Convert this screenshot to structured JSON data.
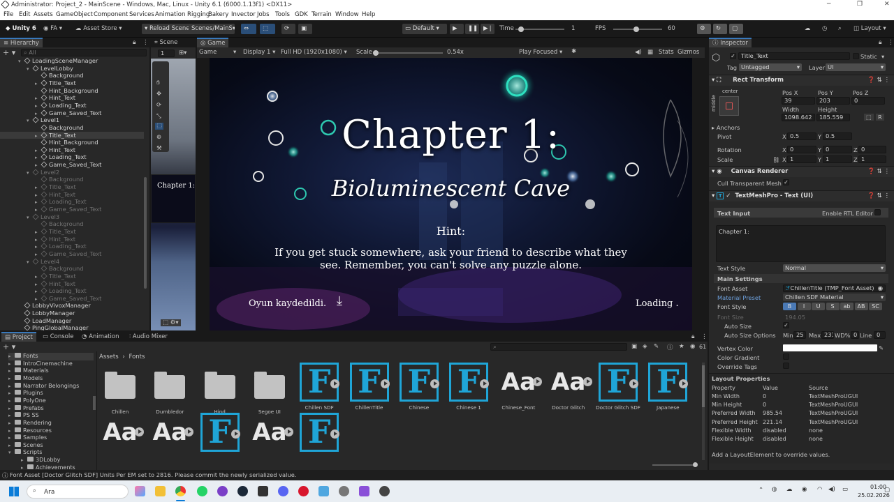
{
  "window": {
    "title": "Administrator: Project_2 - MainScene - Windows, Mac, Linux - Unity 6.1 (6000.1.13f1) <DX11>"
  },
  "menu": [
    "File",
    "Edit",
    "Assets",
    "GameObject",
    "Component",
    "Services",
    "Animation Rigging",
    "Bakery",
    "Invector",
    "Jobs",
    "Tools",
    "GDK",
    "Terrain",
    "Window",
    "Help"
  ],
  "toolbar": {
    "account": "Unity 6",
    "user": "FA",
    "asset_store": "Asset Store",
    "reload_scene": "Reload Scene",
    "scenes": "Scenes/MainS",
    "play_mode": "Default",
    "time_label": "Time",
    "time_value": "1",
    "fps_label": "FPS",
    "fps_value": "60",
    "layout": "Layout"
  },
  "hierarchy": {
    "tab": "Hierarchy",
    "search_placeholder": "All",
    "rows": [
      {
        "label": "LoadingSceneManager",
        "indent": 1,
        "arrow": "▾",
        "dim": false
      },
      {
        "label": "LevelLobby",
        "indent": 2,
        "arrow": "▾",
        "dim": false
      },
      {
        "label": "Background",
        "indent": 3,
        "arrow": "",
        "dim": false
      },
      {
        "label": "Title_Text",
        "indent": 3,
        "arrow": "▸",
        "dim": false
      },
      {
        "label": "Hint_Background",
        "indent": 3,
        "arrow": "",
        "dim": false
      },
      {
        "label": "Hint_Text",
        "indent": 3,
        "arrow": "▸",
        "dim": false
      },
      {
        "label": "Loading_Text",
        "indent": 3,
        "arrow": "▸",
        "dim": false
      },
      {
        "label": "Game_Saved_Text",
        "indent": 3,
        "arrow": "▸",
        "dim": false
      },
      {
        "label": "Level1",
        "indent": 2,
        "arrow": "▾",
        "dim": false
      },
      {
        "label": "Background",
        "indent": 3,
        "arrow": "",
        "dim": false
      },
      {
        "label": "Title_Text",
        "indent": 3,
        "arrow": "▸",
        "dim": false,
        "selected": true
      },
      {
        "label": "Hint_Background",
        "indent": 3,
        "arrow": "",
        "dim": false
      },
      {
        "label": "Hint_Text",
        "indent": 3,
        "arrow": "▸",
        "dim": false
      },
      {
        "label": "Loading_Text",
        "indent": 3,
        "arrow": "▸",
        "dim": false
      },
      {
        "label": "Game_Saved_Text",
        "indent": 3,
        "arrow": "▸",
        "dim": false
      },
      {
        "label": "Level2",
        "indent": 2,
        "arrow": "▾",
        "dim": true
      },
      {
        "label": "Background",
        "indent": 3,
        "arrow": "",
        "dim": true
      },
      {
        "label": "Title_Text",
        "indent": 3,
        "arrow": "▸",
        "dim": true
      },
      {
        "label": "Hint_Text",
        "indent": 3,
        "arrow": "▸",
        "dim": true
      },
      {
        "label": "Loading_Text",
        "indent": 3,
        "arrow": "▸",
        "dim": true
      },
      {
        "label": "Game_Saved_Text",
        "indent": 3,
        "arrow": "▸",
        "dim": true
      },
      {
        "label": "Level3",
        "indent": 2,
        "arrow": "▾",
        "dim": true
      },
      {
        "label": "Background",
        "indent": 3,
        "arrow": "",
        "dim": true
      },
      {
        "label": "Title_Text",
        "indent": 3,
        "arrow": "▸",
        "dim": true
      },
      {
        "label": "Hint_Text",
        "indent": 3,
        "arrow": "▸",
        "dim": true
      },
      {
        "label": "Loading_Text",
        "indent": 3,
        "arrow": "▸",
        "dim": true
      },
      {
        "label": "Game_Saved_Text",
        "indent": 3,
        "arrow": "▸",
        "dim": true
      },
      {
        "label": "Level4",
        "indent": 2,
        "arrow": "▾",
        "dim": true
      },
      {
        "label": "Background",
        "indent": 3,
        "arrow": "",
        "dim": true
      },
      {
        "label": "Title_Text",
        "indent": 3,
        "arrow": "▸",
        "dim": true
      },
      {
        "label": "Hint_Text",
        "indent": 3,
        "arrow": "▸",
        "dim": true
      },
      {
        "label": "Loading_Text",
        "indent": 3,
        "arrow": "▸",
        "dim": true
      },
      {
        "label": "Game_Saved_Text",
        "indent": 3,
        "arrow": "▸",
        "dim": true
      },
      {
        "label": "LobbyVivoxManager",
        "indent": 1,
        "arrow": "",
        "dim": false
      },
      {
        "label": "LobbyManager",
        "indent": 1,
        "arrow": "",
        "dim": false
      },
      {
        "label": "LoadManager",
        "indent": 1,
        "arrow": "",
        "dim": false
      },
      {
        "label": "PingGlobalManager",
        "indent": 1,
        "arrow": "",
        "dim": false
      }
    ]
  },
  "scene_tab": {
    "label": "Scene",
    "zoom": "1"
  },
  "game": {
    "tab": "Game",
    "mode": "Game",
    "display": "Display 1",
    "resolution": "Full HD (1920x1080)",
    "scale_label": "Scale",
    "scale_value": "0.54x",
    "play_focused": "Play Focused",
    "stats": "Stats",
    "gizmos": "Gizmos",
    "title": "Chapter 1:",
    "subtitle": "Bioluminescent Cave",
    "hint_title": "Hint:",
    "hint_line1": "If you get stuck somewhere, ask your friend to describe what they",
    "hint_line2": "see. Remember, you can't solve any puzzle alone.",
    "saved_text": "Oyun kaydedildi.",
    "loading_text": "Loading ."
  },
  "inspector": {
    "tab": "Inspector",
    "object_name": "Title_Text",
    "static_label": "Static",
    "tag_label": "Tag",
    "tag_value": "Untagged",
    "layer_label": "Layer",
    "layer_value": "UI",
    "rect_transform": "Rect Transform",
    "anchor_h": "center",
    "anchor_v": "middle",
    "pos_x_label": "Pos X",
    "pos_x": "39",
    "pos_y_label": "Pos Y",
    "pos_y": "203",
    "pos_z_label": "Pos Z",
    "pos_z": "0",
    "width_label": "Width",
    "width": "1098.642",
    "height_label": "Height",
    "height": "185.559",
    "anchors": "Anchors",
    "pivot_label": "Pivot",
    "pivot_x": "0.5",
    "pivot_y": "0.5",
    "rotation_label": "Rotation",
    "rot_x": "0",
    "rot_y": "0",
    "rot_z": "0",
    "scale_label": "Scale",
    "scale_x": "1",
    "scale_y": "1",
    "scale_z": "1",
    "canvas_renderer": "Canvas Renderer",
    "cull_transparent": "Cull Transparent Mesh",
    "tmp_header": "TextMeshPro - Text (UI)",
    "text_input_label": "Text Input",
    "enable_rtl": "Enable RTL Editor",
    "text_value": "Chapter 1:",
    "text_style_label": "Text Style",
    "text_style_value": "Normal",
    "main_settings": "Main Settings",
    "font_asset_label": "Font Asset",
    "font_asset_value": "ChillenTitle (TMP_Font Asset)",
    "material_label": "Material Preset",
    "material_value": "Chillen SDF Material",
    "font_style_label": "Font Style",
    "font_style_buttons": [
      "B",
      "I",
      "U",
      "S",
      "ab",
      "AB",
      "SC"
    ],
    "font_size_label": "Font Size",
    "font_size_value": "194.05",
    "auto_size_label": "Auto Size",
    "auto_size_options_label": "Auto Size Options",
    "min_label": "Min",
    "min_value": "25",
    "max_label": "Max",
    "max_value": "231",
    "wd_label": "WD%",
    "wd_value": "0",
    "line_label": "Line",
    "line_value": "0",
    "vertex_color_label": "Vertex Color",
    "color_gradient_label": "Color Gradient",
    "override_tags_label": "Override Tags",
    "layout_properties": "Layout Properties",
    "lp_headers": [
      "Property",
      "Value",
      "Source"
    ],
    "lp_rows": [
      [
        "Min Width",
        "0",
        "TextMeshProUGUI"
      ],
      [
        "Min Height",
        "0",
        "TextMeshProUGUI"
      ],
      [
        "Preferred Width",
        "985.54",
        "TextMeshProUGUI"
      ],
      [
        "Preferred Height",
        "221.14",
        "TextMeshProUGUI"
      ],
      [
        "Flexible Width",
        "disabled",
        "none"
      ],
      [
        "Flexible Height",
        "disabled",
        "none"
      ]
    ],
    "lp_footer": "Add a LayoutElement to override values."
  },
  "bottom_tabs": [
    "Project",
    "Console",
    "Animation",
    "Audio Mixer"
  ],
  "project": {
    "breadcrumb_root": "Assets",
    "breadcrumb_sep": "›",
    "breadcrumb_leaf": "Fonts",
    "count": "61",
    "tree": [
      "Fonts",
      "IntroCinemachine",
      "Materials",
      "Models",
      "Narrator Belongings",
      "Plugins",
      "PolyOne",
      "Prefabs",
      "PS SS",
      "Rendering",
      "Resources",
      "Samples",
      "Scenes",
      "Scripts",
      "3DLobby",
      "Achievements"
    ],
    "assets_row1": [
      {
        "name": "Chillen",
        "kind": "folder"
      },
      {
        "name": "Dumbledor",
        "kind": "folder"
      },
      {
        "name": "Hind",
        "kind": "folder"
      },
      {
        "name": "Segoe UI",
        "kind": "folder"
      },
      {
        "name": "Chillen SDF",
        "kind": "tmp"
      },
      {
        "name": "ChillenTitle",
        "kind": "tmp"
      },
      {
        "name": "Chinese",
        "kind": "tmp"
      },
      {
        "name": "Chinese 1",
        "kind": "tmp"
      },
      {
        "name": "Chinese_Font",
        "kind": "font"
      },
      {
        "name": "Doctor Glitch",
        "kind": "font"
      },
      {
        "name": "Doctor Glitch SDF",
        "kind": "tmp"
      },
      {
        "name": "Japanese",
        "kind": "tmp"
      }
    ],
    "assets_row2": [
      {
        "name": "",
        "kind": "font"
      },
      {
        "name": "",
        "kind": "font"
      },
      {
        "name": "",
        "kind": "tmp"
      },
      {
        "name": "",
        "kind": "font"
      },
      {
        "name": "",
        "kind": "tmp"
      }
    ],
    "tmp_letter": "F",
    "font_letters": "Aa"
  },
  "status_bar": {
    "message": "Font Asset [Doctor Glitch SDF] Units Per EM set to 2816. Please commit the newly serialized value."
  },
  "taskbar": {
    "search_placeholder": "Ara",
    "time": "01:00",
    "date": "25.02.2026"
  },
  "colors": {
    "accent": "#3a79bb",
    "tmp_blue": "#1fa5d7",
    "editor_bg": "#282828"
  }
}
